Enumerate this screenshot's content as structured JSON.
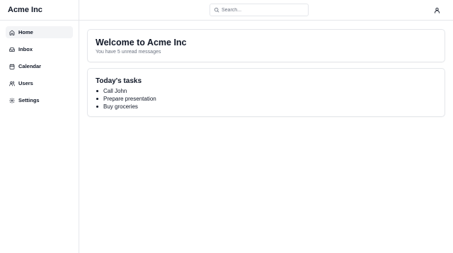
{
  "app": {
    "brand": "Acme Inc"
  },
  "sidebar": {
    "items": [
      {
        "label": "Home",
        "icon": "home-icon",
        "active": true
      },
      {
        "label": "Inbox",
        "icon": "inbox-icon",
        "active": false
      },
      {
        "label": "Calendar",
        "icon": "calendar-icon",
        "active": false
      },
      {
        "label": "Users",
        "icon": "users-icon",
        "active": false
      },
      {
        "label": "Settings",
        "icon": "gear-icon",
        "active": false
      }
    ]
  },
  "header": {
    "search": {
      "placeholder": "Search...",
      "value": ""
    },
    "user_icon": "user-icon"
  },
  "main": {
    "welcome": {
      "title": "Welcome to Acme Inc",
      "subtitle": "You have 5 unread messages"
    },
    "tasks": {
      "title": "Today's tasks",
      "items": [
        "Call John",
        "Prepare presentation",
        "Buy groceries"
      ]
    }
  },
  "colors": {
    "border": "#e5e7eb",
    "active_bg": "#f3f4f6",
    "text": "#111827",
    "muted": "#6b7280"
  }
}
